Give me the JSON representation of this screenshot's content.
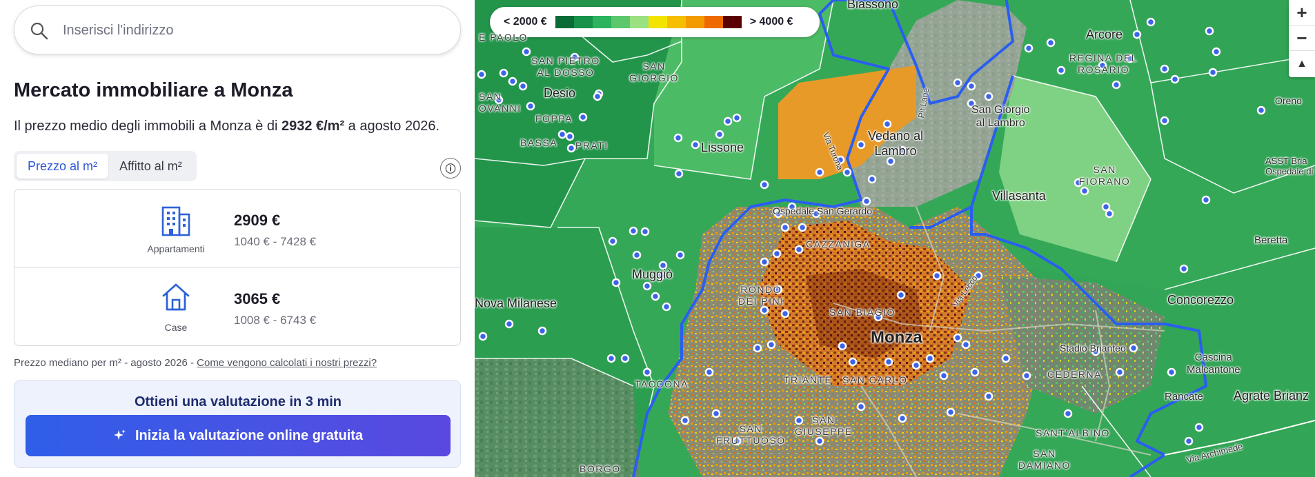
{
  "search": {
    "placeholder": "Inserisci l'indirizzo"
  },
  "title": "Mercato immobiliare a Monza",
  "subtitle": {
    "before": "Il prezzo medio degli immobili a Monza è di ",
    "value": "2932 €/m²",
    "after": " a agosto 2026."
  },
  "tabs": [
    {
      "label": "Prezzo al m²",
      "active": true
    },
    {
      "label": "Affitto al m²",
      "active": false
    }
  ],
  "info_glyph": "ⓘ",
  "property_types": [
    {
      "label": "Appartamenti",
      "icon": "building-icon",
      "price": "2909 €",
      "range": "1040 € - 7428 €"
    },
    {
      "label": "Case",
      "icon": "house-icon",
      "price": "3065 €",
      "range": "1008 € - 6743 €"
    }
  ],
  "note": {
    "text": "Prezzo mediano per m² - agosto 2026 - ",
    "link": "Come vengono calcolati i nostri prezzi?"
  },
  "cta": {
    "title": "Ottieni una valutazione in 3 min",
    "button": "Inizia la valutazione online gratuita"
  },
  "legend": {
    "low": "< 2000 €",
    "high": "> 4000 €",
    "colors": [
      "#0b6b36",
      "#16924a",
      "#2bb35d",
      "#5cc86b",
      "#9be081",
      "#f3e400",
      "#f5be00",
      "#f39a00",
      "#ee6a00",
      "#5a0000"
    ]
  },
  "zoom": {
    "in": "+",
    "out": "−",
    "compass": "▲"
  },
  "map_labels": {
    "biassono": "Biassono",
    "e_paolo": "E PAOLO",
    "san_pietro": "SAN PIETRO\nAL DOSSO",
    "san_giorgio": "SAN\nGIORGIO",
    "desio": "Desio",
    "san_giovanni": "SAN\nOVANNI",
    "foppa": "FOPPA",
    "bassa": "BASSA",
    "prati": "PRATI",
    "lissone": "Lissone",
    "via_turona": "Via Turona",
    "vedano": "Vedano al\nLambro",
    "pit_lane": "Pit Lane",
    "arcore": "Arcore",
    "regina": "REGINA DEL\nROSARIO",
    "oreno": "Oreno",
    "san_giorgio_lambro": "San Giorgio\nal Lambro",
    "asst": "ASST Bria\nOspedale di Vi",
    "san_fiorano": "SAN\nFIORANO",
    "villasanta": "Villasanta",
    "ospedale": "Ospedale San Gerardo",
    "cazzaniga": "CAZZANIGA",
    "beretta": "Beretta",
    "muggio": "Muggiò",
    "rondo": "RONDÒ\nDEI PINI",
    "via_lecco": "Via Lecco",
    "nova_milanese": "Nova Milanese",
    "concorezzo": "Concorezzo",
    "san_biagio": "SAN BIAGIO",
    "monza": "Monza",
    "stadio": "Stadio Brianteo",
    "cascina": "Cascina\nMalcantone",
    "taccona": "TACCONA",
    "triante": "TRIANTE",
    "san_carlo": "SAN CARLO",
    "cederna": "CEDERNA",
    "rancate": "Rancate",
    "agrate": "Agrate Brianz",
    "san_fruttuoso": "SAN\nFRUTTUOSO",
    "san_giuseppe": "SAN\nGIUSEPPE",
    "sant_albino": "SANT'ALBINO",
    "via_archimede": "Via Archimede",
    "borgo": "BORGO",
    "san_damiano": "SAN\nDAMIANO"
  }
}
